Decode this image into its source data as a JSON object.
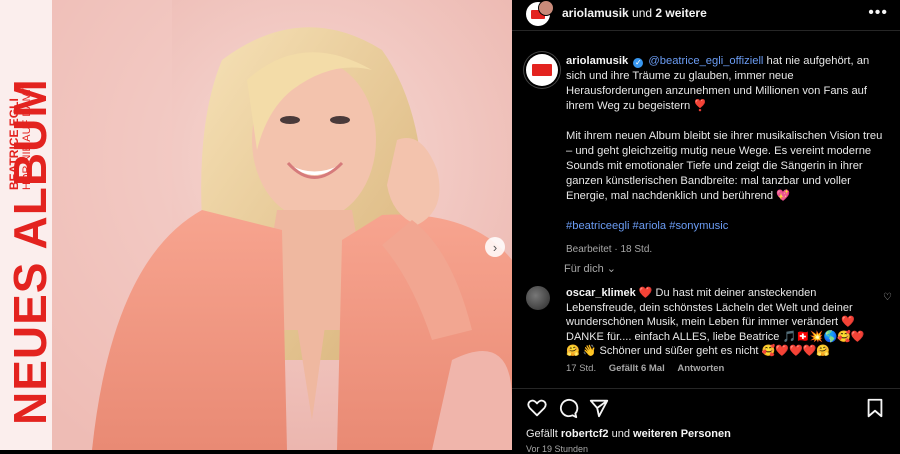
{
  "media": {
    "vertical_big": "NEUES ALBUM",
    "vertical_artist": "BEATRICE EGLI",
    "vertical_album": "HÖR NIE AUF DAMIT"
  },
  "header": {
    "username": "ariolamusik",
    "and_text": " und ",
    "others": "2 weitere"
  },
  "caption": {
    "username": "ariolamusik",
    "mention": "@beatrice_egli_offiziell",
    "p1_rest": " hat nie aufgehört, an sich und ihre Träume zu glauben, immer neue Herausforderungen anzunehmen und Millionen von Fans auf ihrem Weg zu begeistern ❣️",
    "p2": "Mit ihrem neuen Album bleibt sie ihrer musikalischen Vision treu – und geht gleichzeitig mutig neue Wege. Es vereint moderne Sounds mit emotionaler Tiefe und zeigt die Sängerin in ihrer ganzen künstlerischen Bandbreite: mal tanzbar und voller Energie, mal nachdenklich und berührend 💖",
    "hashtags": "#beatriceegli #ariola #sonymusic",
    "edited": "Bearbeitet · 18 Std."
  },
  "for_you": "Für dich ⌄",
  "comment": {
    "username": "oscar_klimek",
    "text": " ❤️ Du hast mit deiner ansteckenden Lebensfreude, dein schönstes Lächeln det Welt und deiner wunderschönen Musik, mein Leben für immer verändert ❤️ DANKE für.... einfach ALLES, liebe Beatrice 🎵🇨🇭💥🌎🥰❤️🤗 👋 Schöner und süßer geht es nicht 🥰❤️❤️❤️🤗",
    "time": "17 Std.",
    "likes": "Gefällt 6 Mal",
    "reply": "Antworten"
  },
  "likes": {
    "prefix": "Gefällt ",
    "user": "robertcf2",
    "middle": " und ",
    "rest": "weiteren Personen"
  },
  "timestamp": "Vor 19 Stunden",
  "colors": {
    "brand_red": "#e3231f",
    "link_blue": "#6b9cf3",
    "background": "#000000"
  }
}
